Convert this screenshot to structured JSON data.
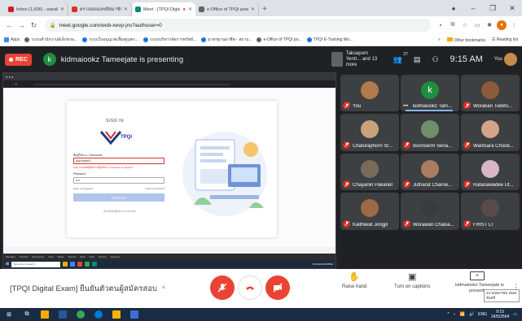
{
  "browser": {
    "tabs": [
      {
        "label": "Inbox (1,606) - warakorn@tpqi.go",
        "color": "#c5221f",
        "active": false
      },
      {
        "label": "ตรวจสอบเลขที่สมาชิก (ผลลัพธ์การตรวจ",
        "color": "#d93025",
        "active": false
      },
      {
        "label": "Meet - [TPQI Digital Exam] -",
        "color": "#00897b",
        "active": true
      },
      {
        "label": "e-Office of TPQI powered by Cy",
        "color": "#5f6368",
        "active": false
      }
    ],
    "new_tab": "+",
    "window_controls": [
      "–",
      "❐",
      "✕"
    ],
    "url": "meet.google.com/wob-xevp-jns?authuser=0",
    "bookmarks": [
      {
        "label": "Apps",
        "color": "#4285f4"
      },
      {
        "label": "ระบบสำนักงานอิเล็กทรอ...",
        "color": "#5f6368"
      },
      {
        "label": "ระบบใบอนุญาตเลี้ยงดูบุตร...",
        "color": "#1a73e8"
      },
      {
        "label": "ระบบบริหารจัดการทรัพย์...",
        "color": "#1a73e8"
      },
      {
        "label": "มาตรฐานอาชีพ - สถาบ...",
        "color": "#1a73e8"
      },
      {
        "label": "e-Office of TPQI po...",
        "color": "#5f6368"
      },
      {
        "label": "TPQI E-Training Mo...",
        "color": "#1a73e8"
      }
    ],
    "bookmarks_more": "»",
    "other_bookmarks": "Other bookmarks",
    "reading_list": "Reading list"
  },
  "meet": {
    "rec_label": "REC",
    "presenter_initial": "k",
    "presenting_text": "kidmaiookz Tameejate is presenting",
    "others_label": "Taksaporn Yentr... and 13 more",
    "people_count": "27",
    "time": "9:15 AM",
    "you_label": "You",
    "participants": [
      {
        "name": "You",
        "face": "#b07a4a",
        "letter": "",
        "muted": true,
        "speaking": false
      },
      {
        "name": "kidmaiookz Tam...",
        "face": "",
        "letter": "k",
        "muted": false,
        "speaking": true
      },
      {
        "name": "Worakan Tukkhi...",
        "face": "#8d5a3b",
        "letter": "",
        "muted": true,
        "speaking": false
      },
      {
        "name": "Chaturaphorn Sr...",
        "face": "#c9a27a",
        "letter": "",
        "muted": true,
        "speaking": false
      },
      {
        "name": "Boonserm Sena...",
        "face": "#6f8f6a",
        "letter": "",
        "muted": true,
        "speaking": false
      },
      {
        "name": "Waritsara Choob...",
        "face": "#d4a48a",
        "letter": "",
        "muted": true,
        "speaking": false
      },
      {
        "name": "Chayanin Pakanet",
        "face": "#7a6a5a",
        "letter": "",
        "muted": true,
        "speaking": false
      },
      {
        "name": "Jutharat Charoe...",
        "face": "#a97d62",
        "letter": "",
        "muted": true,
        "speaking": false
      },
      {
        "name": "Ratanawadee Ut...",
        "face": "#d8b6c4",
        "letter": "",
        "muted": true,
        "speaking": false
      },
      {
        "name": "Kaithiwat Jongjit",
        "face": "#9c6b45",
        "letter": "",
        "muted": true,
        "speaking": false
      },
      {
        "name": "Worawan Chaisa...",
        "face": "#3a3a3a",
        "letter": "",
        "muted": true,
        "speaking": false
      },
      {
        "name": "FIRST LT",
        "face": "#5a4a4a",
        "letter": "",
        "muted": true,
        "speaking": false
      }
    ]
  },
  "shared_screen": {
    "signin": "SIGN IN",
    "brand_text": "TPQI",
    "id_label": "ชื่อผู้ใช้งาน / Username",
    "id_value": "tpqi.exam01",
    "id_error": "กรุณากรอกชื่อผู้ใช้งานให้ถูกต้อง / Username is required",
    "pwd_label": "Password",
    "pwd_value": "••••",
    "forgot_left": "Keep me logged in",
    "forgot_right": "Forgot password?",
    "login_btn": "เข้าสู่ระบบ",
    "footnote": "ยังไม่มีบัญชีผู้ใช้งาน ลงทะเบียน",
    "appbar_items": [
      "Manager",
      "Preview",
      "Extensions",
      "View",
      "Share",
      "Record",
      "Web",
      "Chat",
      "Service",
      "Request"
    ],
    "search": "Type here to search",
    "time": "9:15 AM 24/5/2564"
  },
  "controls": {
    "meeting_title": "[TPQI Digital Exam] ยืนยันตัวตนผู้สมัครสอบ",
    "raise_hand": "Raise hand",
    "captions": "Turn on captions",
    "presenting_label": "kidmaiookz Tameejate is presenting",
    "tooltip": "24 พฤษภาคม 2564 จันทร์"
  },
  "taskbar": {
    "lang": "ENG",
    "time": "9:15",
    "date": "24/5/2564"
  }
}
